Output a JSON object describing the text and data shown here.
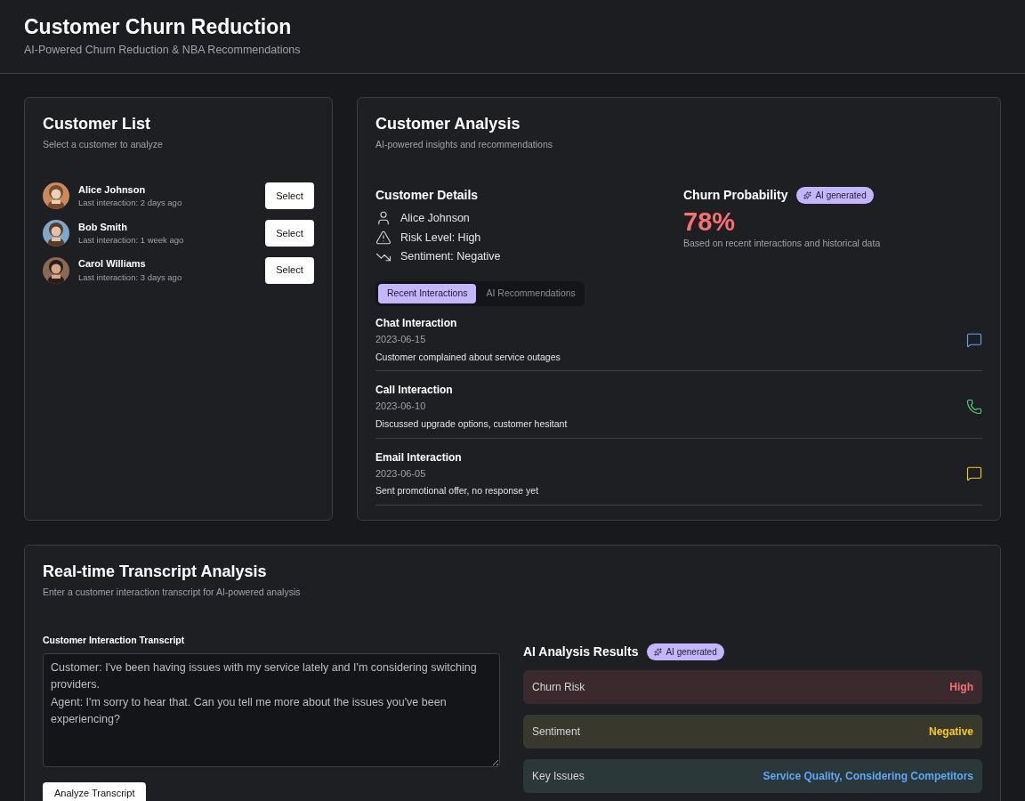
{
  "header": {
    "title": "Customer Churn Reduction",
    "subtitle": "AI-Powered Churn Reduction & NBA Recommendations"
  },
  "customer_list": {
    "title": "Customer List",
    "subtitle": "Select a customer to analyze",
    "customers": [
      {
        "name": "Alice Johnson",
        "last_interaction": "Last interaction: 2 days ago",
        "button_label": "Select"
      },
      {
        "name": "Bob Smith",
        "last_interaction": "Last interaction: 1 week ago",
        "button_label": "Select"
      },
      {
        "name": "Carol Williams",
        "last_interaction": "Last interaction: 3 days ago",
        "button_label": "Select"
      }
    ]
  },
  "analysis": {
    "title": "Customer Analysis",
    "subtitle": "AI-powered insights and recommendations",
    "details_title": "Customer Details",
    "details": [
      {
        "kind": "person",
        "text": "Alice Johnson"
      },
      {
        "kind": "risk",
        "text": "Risk Level: High"
      },
      {
        "kind": "sentiment",
        "text": "Sentiment: Negative"
      }
    ],
    "churn_title": "Churn Probability",
    "badge": "AI generated",
    "churn_value": "78%",
    "churn_note": "Based on recent interactions and historical data",
    "tabs": [
      {
        "label": "Recent Interactions",
        "selected": true
      },
      {
        "label": "AI Recommendations",
        "selected": false
      }
    ],
    "interactions": [
      {
        "kind": "chat",
        "title": "Chat Interaction",
        "date": "2023-06-15",
        "note": "Customer complained about service outages"
      },
      {
        "kind": "call",
        "title": "Call Interaction",
        "date": "2023-06-10",
        "note": "Discussed upgrade options, customer hesitant"
      },
      {
        "kind": "email",
        "title": "Email Interaction",
        "date": "2023-06-05",
        "note": "Sent promotional offer, no response yet"
      }
    ]
  },
  "transcript": {
    "title": "Real-time Transcript Analysis",
    "subtitle": "Enter a customer interaction transcript for AI-powered analysis",
    "field_label": "Customer Interaction Transcript",
    "value": "Customer: I've been having issues with my service lately and I'm considering switching providers.\nAgent: I'm sorry to hear that. Can you tell me more about the issues you've been experiencing?",
    "button": "Analyze Transcript",
    "results_title": "AI Analysis Results",
    "badge": "AI generated",
    "results": [
      {
        "kind": "danger",
        "label": "Churn Risk",
        "value": "High"
      },
      {
        "kind": "warning",
        "label": "Sentiment",
        "value": "Negative"
      },
      {
        "kind": "info",
        "label": "Key Issues",
        "value": "Service Quality, Considering Competitors"
      }
    ]
  }
}
